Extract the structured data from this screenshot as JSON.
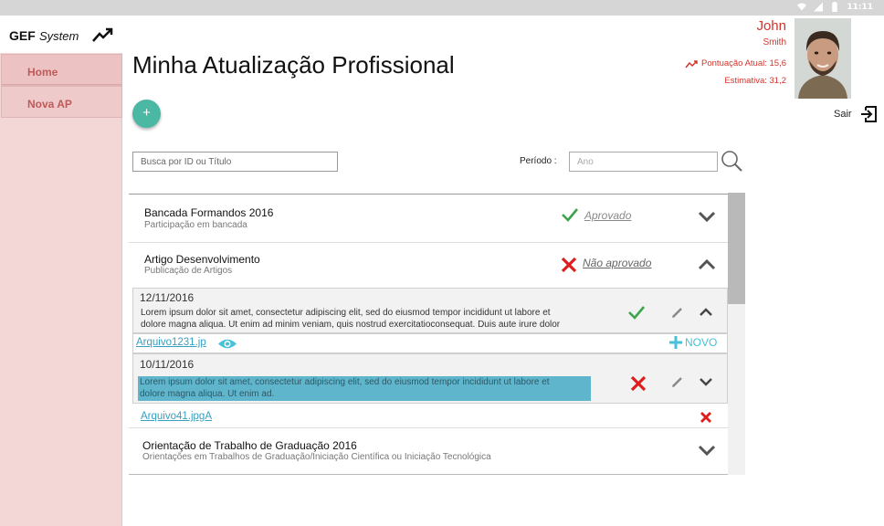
{
  "statusbar": {
    "time": "11:11"
  },
  "brand": {
    "name": "GEF",
    "suffix": "System"
  },
  "nav": [
    {
      "label": "Home"
    },
    {
      "label": "Nova AP"
    }
  ],
  "page": {
    "title": "Minha Atualização Profissional",
    "add_label": "+"
  },
  "user": {
    "first_name": "John",
    "last_name": "Smith",
    "score": "Pontuação Atual: 15,6",
    "estimate": "Estimativa: 31,2",
    "logout": "Sair"
  },
  "search": {
    "placeholder": "Busca por ID ou Título",
    "period_label": "Período :",
    "year_placeholder": "Ano"
  },
  "colors": {
    "accent_red": "#d0342c",
    "fab": "#4bb8a3",
    "link_blue": "#37a0c0",
    "approved_green": "#3aa54a",
    "rejected_red": "#dd1e1e"
  },
  "items": [
    {
      "title": "Bancada Formandos 2016",
      "subtitle": "Participação em bancada",
      "status": "Aprovado",
      "status_icon": "check-icon",
      "expanded": false
    },
    {
      "title": "Artigo Desenvolvimento",
      "subtitle": "Publicação de Artigos",
      "status": "Não aprovado",
      "status_icon": "x-icon",
      "expanded": true,
      "submissions": [
        {
          "date": "12/11/2016",
          "desc_line1": "Lorem ipsum dolor sit amet, consectetur adipiscing elit, sed do eiusmod tempor incididunt ut labore et",
          "desc_line2": "dolore magna aliqua. Ut enim ad minim veniam, quis nostrud exercitatioconsequat. Duis aute irure dolor",
          "status_icon": "check-icon",
          "file": "Arquivo1231.jp",
          "new_label": "NOVO"
        },
        {
          "date": "10/11/2016",
          "desc_line1": "Lorem ipsum dolor sit amet, consectetur adipiscing elit, sed do eiusmod tempor incididunt ut labore et",
          "desc_line2": "dolore magna aliqua. Ut enim ad.",
          "status_icon": "x-icon",
          "file": "Arquivo41.jpgA"
        }
      ]
    },
    {
      "title": "Orientação de Trabalho de Graduação 2016",
      "subtitle": "Orientações em Trabalhos de Graduação/Iniciação Científica ou Iniciação Tecnológica",
      "expanded": false
    }
  ]
}
